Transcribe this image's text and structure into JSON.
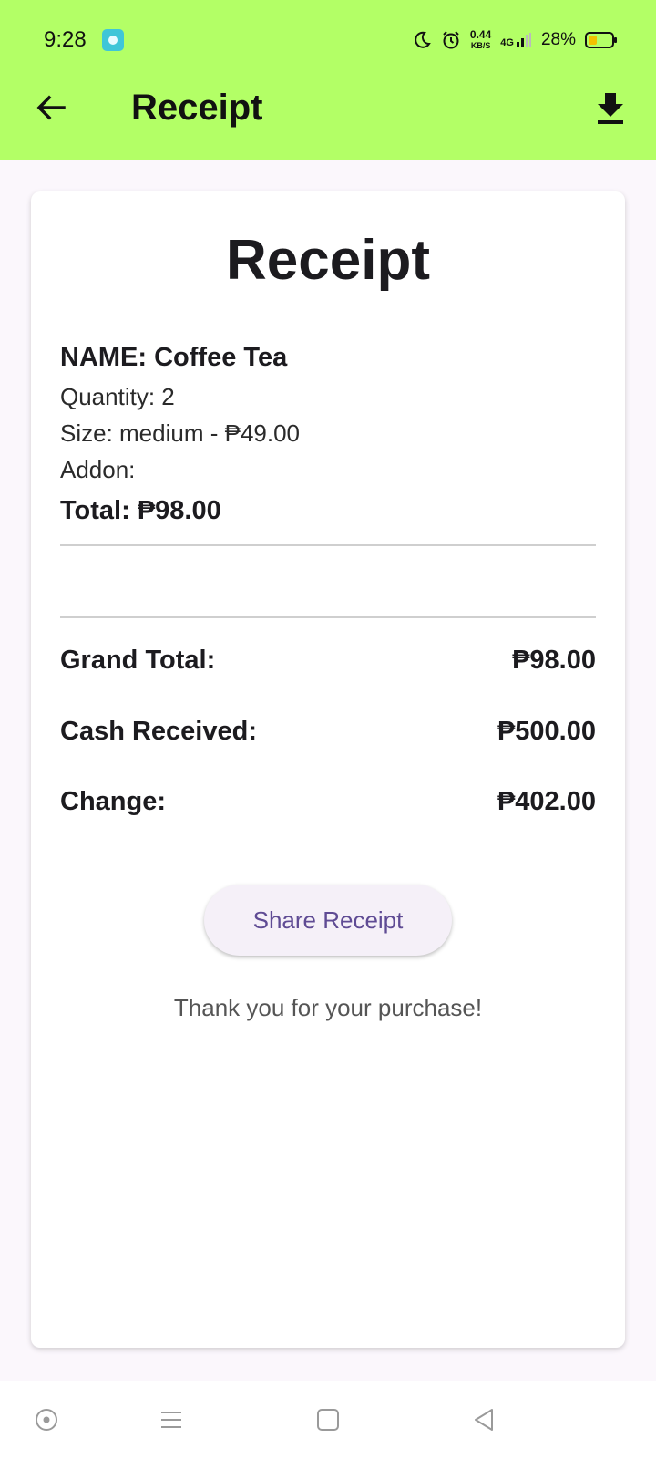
{
  "status_bar": {
    "time": "9:28",
    "app_icon": "message-app-icon",
    "icons": [
      "moon-icon",
      "alarm-icon"
    ],
    "network_speed": "0.44",
    "network_unit": "KB/S",
    "signal_label": "4G",
    "battery": "28%",
    "battery_fill": 0.28
  },
  "app_bar": {
    "title": "Receipt",
    "back_icon": "arrow-back-icon",
    "action_icon": "download-icon",
    "background_color": "#b3ff66"
  },
  "receipt": {
    "title": "Receipt",
    "item": {
      "name": "NAME: Coffee Tea",
      "quantity": "Quantity: 2",
      "size": "Size: medium - ₱49.00",
      "addon": "Addon:",
      "total": "Total: ₱98.00"
    },
    "summary": [
      {
        "label": "Grand Total:",
        "value": "₱98.00"
      },
      {
        "label": "Cash Received:",
        "value": "₱500.00"
      },
      {
        "label": "Change:",
        "value": "₱402.00"
      }
    ],
    "share_button": "Share Receipt",
    "thank_you": "Thank you for your purchase!"
  },
  "nav_bar": {
    "buttons": [
      "assistant-icon",
      "menu-icon",
      "home-icon",
      "back-triangle-icon"
    ]
  },
  "colors": {
    "accent": "#b3ff66",
    "button_text": "#5f4b94"
  }
}
